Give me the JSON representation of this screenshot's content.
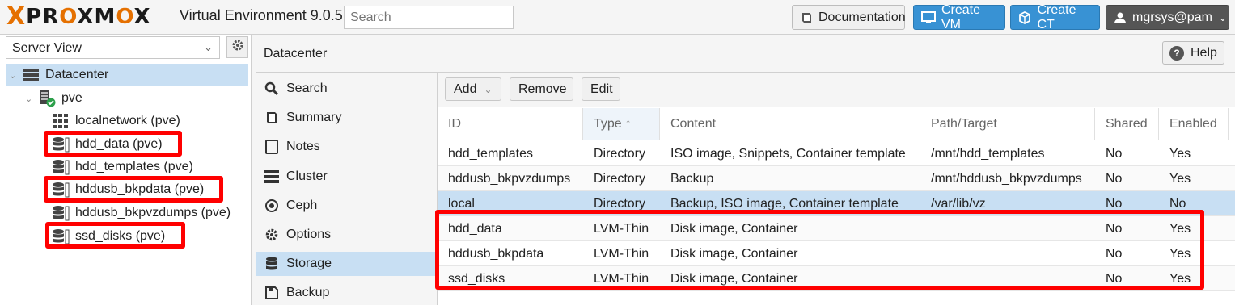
{
  "header": {
    "logo_x": "X",
    "logo_pr": "PR",
    "logo_o1": "O",
    "logo_xm": "XM",
    "logo_o2": "O",
    "logo_x2": "X",
    "product_title": "Virtual Environment 9.0.5",
    "search_placeholder": "Search",
    "documentation_label": "Documentation",
    "create_vm_label": "Create VM",
    "create_ct_label": "Create CT",
    "user_label": "mgrsys@pam"
  },
  "sidebar": {
    "view_select": "Server View",
    "tree": [
      {
        "label": "Datacenter",
        "icon": "server-rack-icon",
        "selected": true
      },
      {
        "label": "pve",
        "icon": "node-online-icon"
      },
      {
        "label": "localnetwork (pve)",
        "icon": "grid-icon"
      },
      {
        "label": "hdd_data (pve)",
        "icon": "database-icon",
        "highlighted": true
      },
      {
        "label": "hdd_templates (pve)",
        "icon": "database-icon"
      },
      {
        "label": "hddusb_bkpdata (pve)",
        "icon": "database-icon",
        "highlighted": true
      },
      {
        "label": "hddusb_bkpvzdumps (pve)",
        "icon": "database-icon"
      },
      {
        "label": "ssd_disks (pve)",
        "icon": "database-icon",
        "highlighted": true
      }
    ]
  },
  "content": {
    "title": "Datacenter",
    "help_label": "Help",
    "nav": [
      {
        "label": "Search",
        "icon": "search-icon"
      },
      {
        "label": "Summary",
        "icon": "book-icon"
      },
      {
        "label": "Notes",
        "icon": "notes-icon"
      },
      {
        "label": "Cluster",
        "icon": "cluster-icon"
      },
      {
        "label": "Ceph",
        "icon": "ceph-icon"
      },
      {
        "label": "Options",
        "icon": "gear-icon"
      },
      {
        "label": "Storage",
        "icon": "database-icon",
        "selected": true
      },
      {
        "label": "Backup",
        "icon": "floppy-icon"
      }
    ],
    "toolbar": {
      "add_label": "Add",
      "remove_label": "Remove",
      "edit_label": "Edit"
    },
    "columns": [
      "ID",
      "Type",
      "Content",
      "Path/Target",
      "Shared",
      "Enabled"
    ],
    "sort_indicator": "↑",
    "rows": [
      {
        "id": "hdd_templates",
        "type": "Directory",
        "content": "ISO image, Snippets, Container template",
        "path": "/mnt/hdd_templates",
        "shared": "No",
        "enabled": "Yes"
      },
      {
        "id": "hddusb_bkpvzdumps",
        "type": "Directory",
        "content": "Backup",
        "path": "/mnt/hddusb_bkpvzdumps",
        "shared": "No",
        "enabled": "Yes"
      },
      {
        "id": "local",
        "type": "Directory",
        "content": "Backup, ISO image, Container template",
        "path": "/var/lib/vz",
        "shared": "No",
        "enabled": "No"
      },
      {
        "id": "hdd_data",
        "type": "LVM-Thin",
        "content": "Disk image, Container",
        "path": "",
        "shared": "No",
        "enabled": "Yes"
      },
      {
        "id": "hddusb_bkpdata",
        "type": "LVM-Thin",
        "content": "Disk image, Container",
        "path": "",
        "shared": "No",
        "enabled": "Yes"
      },
      {
        "id": "ssd_disks",
        "type": "LVM-Thin",
        "content": "Disk image, Container",
        "path": "",
        "shared": "No",
        "enabled": "Yes"
      }
    ]
  },
  "colors": {
    "accent": "#3892d4",
    "brand": "#e57000",
    "selection": "#c8dff3",
    "highlight": "#ff0000"
  }
}
